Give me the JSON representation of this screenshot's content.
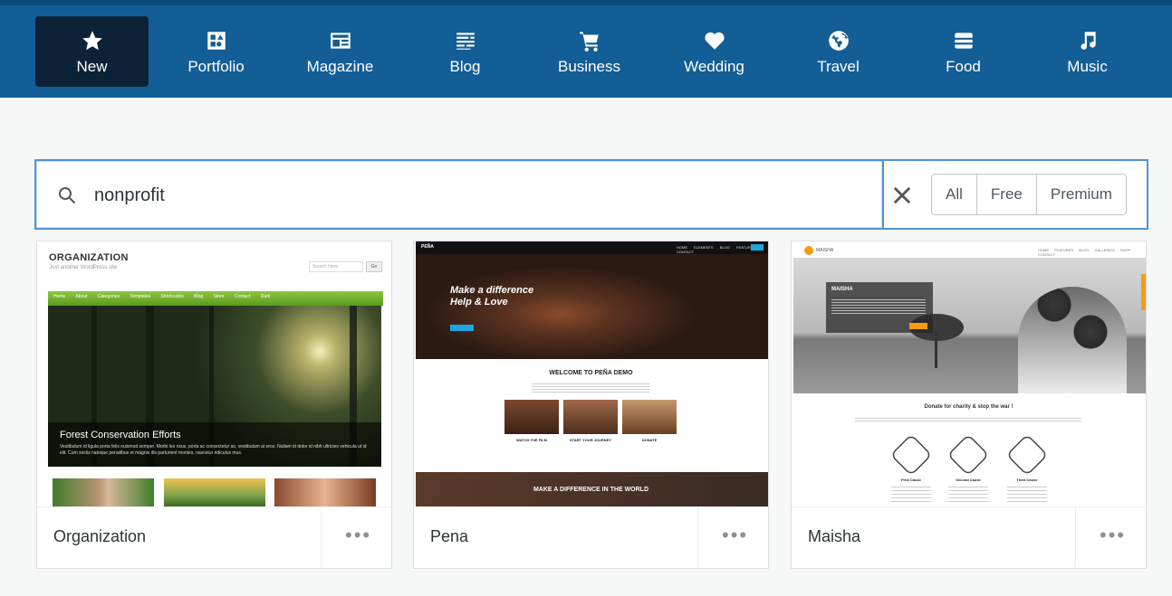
{
  "nav": {
    "items": [
      {
        "label": "New",
        "icon": "star-icon"
      },
      {
        "label": "Portfolio",
        "icon": "portfolio-icon"
      },
      {
        "label": "Magazine",
        "icon": "magazine-icon"
      },
      {
        "label": "Blog",
        "icon": "blog-icon"
      },
      {
        "label": "Business",
        "icon": "cart-icon"
      },
      {
        "label": "Wedding",
        "icon": "heart-icon"
      },
      {
        "label": "Travel",
        "icon": "globe-icon"
      },
      {
        "label": "Food",
        "icon": "food-icon"
      },
      {
        "label": "Music",
        "icon": "music-icon"
      }
    ],
    "active": "New"
  },
  "search": {
    "value": "nonprofit",
    "filters": [
      "All",
      "Free",
      "Premium"
    ]
  },
  "colors": {
    "nav_bg": "#135e96",
    "nav_active": "#0c2236",
    "focus": "#4f94d4"
  },
  "themes": [
    {
      "name": "Organization",
      "preview": {
        "site_title": "ORGANIZATION",
        "tagline": "Just another WordPress site",
        "search_placeholder": "Search Here",
        "search_button": "Go",
        "menu": "Home  About  Categories  Templates  Shortcodes  Blog  Store  Contact  Dark",
        "headline": "Forest Conservation Efforts",
        "excerpt": "Vestibulum id ligula porta felis euismod semper. Morbi leo risus, porta ac consectetur ac, vestibulum at eros. Nullam id dolor id nibh ultricies vehicula ut id elit. Cum sociis natoque penatibus et magnis dis parturient montes, nascetur ridiculus mus."
      }
    },
    {
      "name": "Pena",
      "preview": {
        "logo": "PEÑA",
        "menu": "HOME  ELEMENTS  BLOG  FEATURES  CONTACT",
        "hero_line1": "Make a difference",
        "hero_line2": "Help & Love",
        "welcome": "WELCOME TO PEÑA DEMO",
        "feature1": "WATCH THE FILM",
        "feature2": "START YOUR JOURNEY",
        "feature3": "DONATE",
        "banner": "MAKE A DIFFERENCE IN THE WORLD"
      }
    },
    {
      "name": "Maisha",
      "preview": {
        "logo": "MAISHA",
        "menu": "HOME  FEATURES  BLOG  GALLERIES  SHOP  CONTACT",
        "hero_title": "MAISHA",
        "donate_heading": "Donate for charity & stop the war !",
        "cause1": "First Cause",
        "cause2": "Second Cause",
        "cause3": "Third Cause"
      }
    }
  ],
  "more_label": "•••"
}
